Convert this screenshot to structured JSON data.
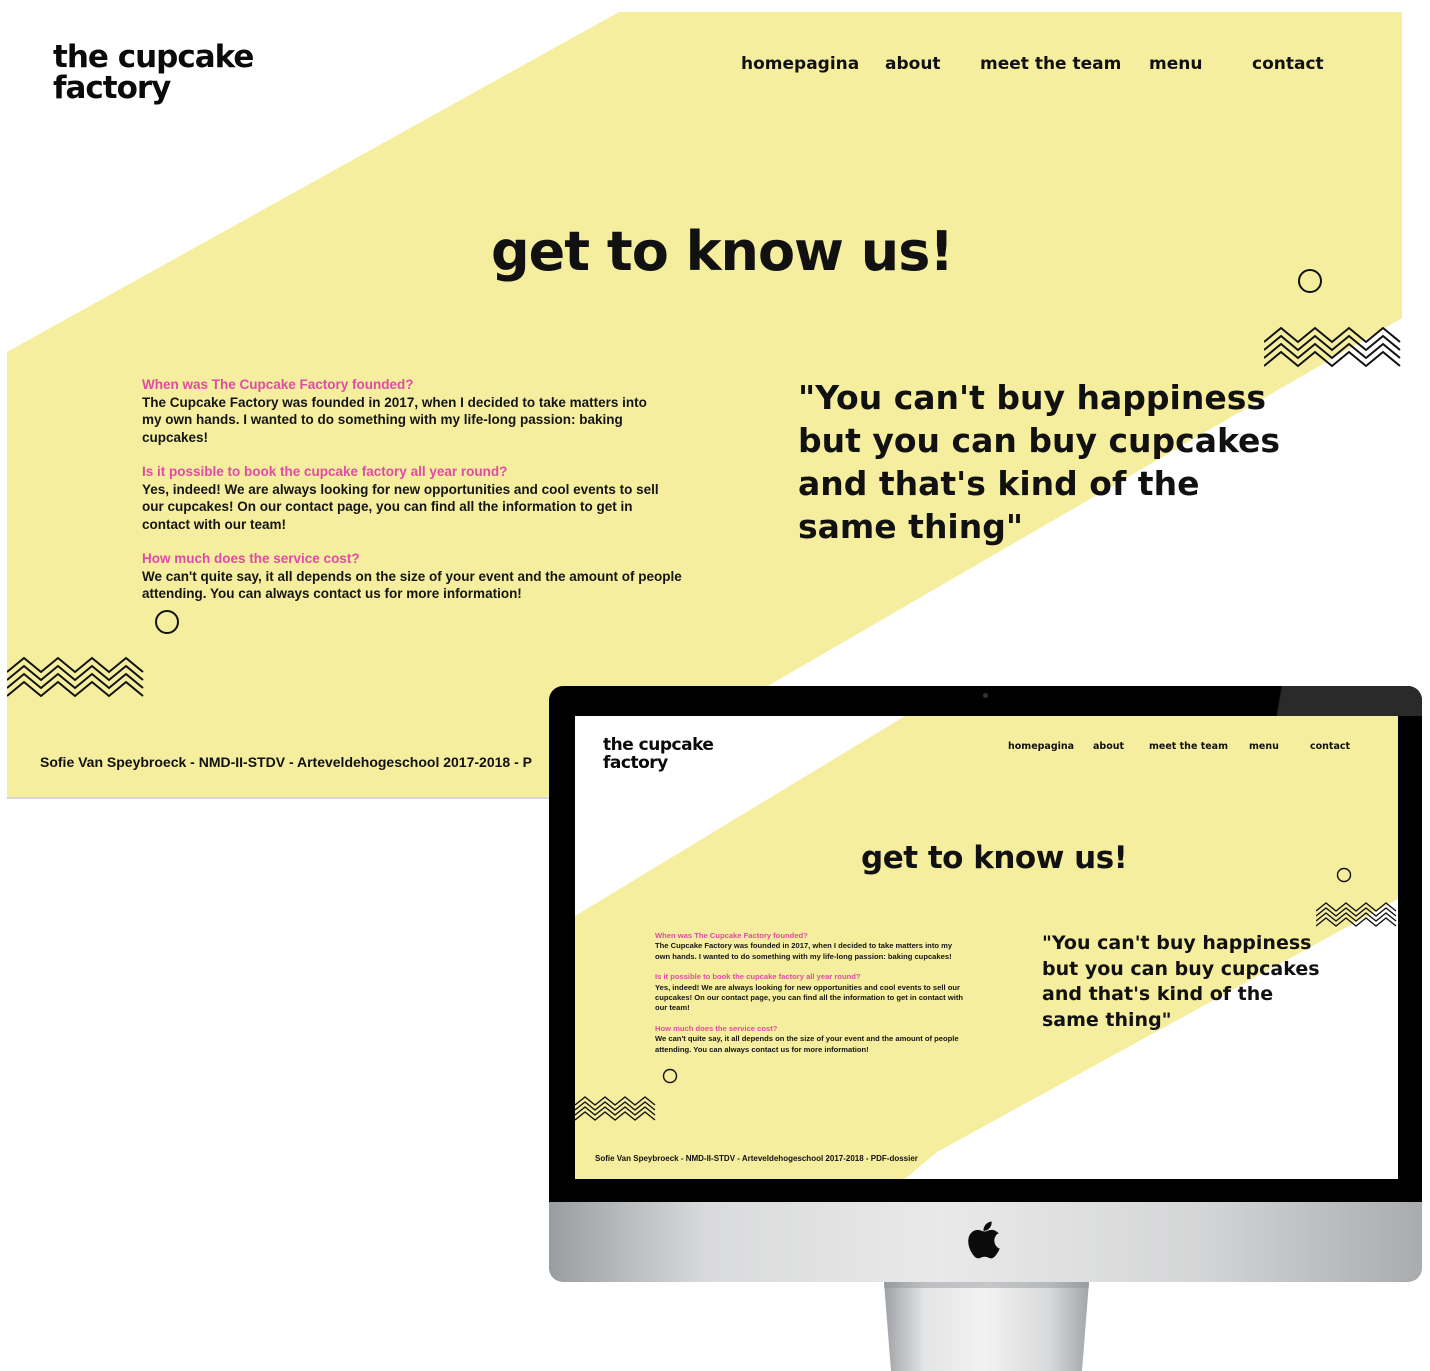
{
  "brand": {
    "line1": "the cupcake",
    "line2": "factory"
  },
  "nav": {
    "homepagina": "homepagina",
    "about": "about",
    "team": "meet the team",
    "menu": "menu",
    "contact": "contact"
  },
  "hero": {
    "title": "get to know us!"
  },
  "faq": [
    {
      "q": "When was The Cupcake Factory founded?",
      "a": "The Cupcake Factory was founded in 2017, when I decided to take matters into my own hands. I wanted to do something with my life-long passion: baking cupcakes!"
    },
    {
      "q": "Is it possible to book the cupcake factory all year round?",
      "a": "Yes, indeed! We are always looking for new opportunities and cool events to sell our cupcakes! On our contact page, you can find all the information to get in contact with our team!"
    },
    {
      "q": "How much does the service cost?",
      "a": "We can't quite say, it all depends on the size of your event and the amount of people attending. You can always contact us for more information!"
    }
  ],
  "quote": {
    "line1": "\"You can't buy happiness",
    "line2": "but you can buy cupcakes",
    "line3": "and that's kind of the",
    "line4": "same thing\""
  },
  "footer": {
    "credit_full": "Sofie Van Speybroeck - NMD-II-STDV - Arteveldehogeschool 2017-2018 - PDF-dossier",
    "credit_cut": "Sofie Van Speybroeck - NMD-II-STDV - Arteveldehogeschool 2017-2018 - P"
  },
  "colors": {
    "yellow": "#f5ee9e",
    "pink": "#e24aa7",
    "ink": "#111111"
  },
  "icons": [
    "circle-outline-icon",
    "zigzag-lines-icon",
    "apple-logo-icon"
  ]
}
